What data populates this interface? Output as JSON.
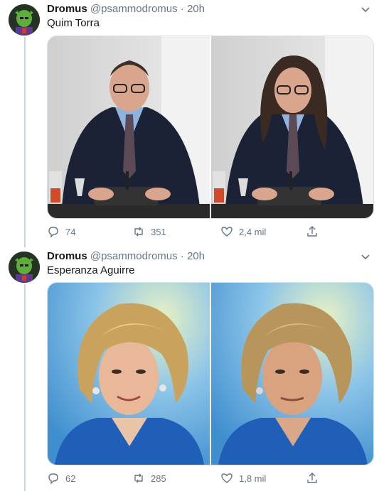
{
  "tweets": [
    {
      "author_name": "Dromus",
      "handle": "@psammodromus",
      "separator": "·",
      "time": "20h",
      "text": "Quim Torra",
      "replies": "74",
      "retweets": "351",
      "likes": "2,4 mil"
    },
    {
      "author_name": "Dromus",
      "handle": "@psammodromus",
      "separator": "·",
      "time": "20h",
      "text": "Esperanza Aguirre",
      "replies": "62",
      "retweets": "285",
      "likes": "1,8 mil"
    }
  ],
  "colors": {
    "text": "#14171a",
    "muted": "#657786",
    "border": "#ccd6dd"
  }
}
